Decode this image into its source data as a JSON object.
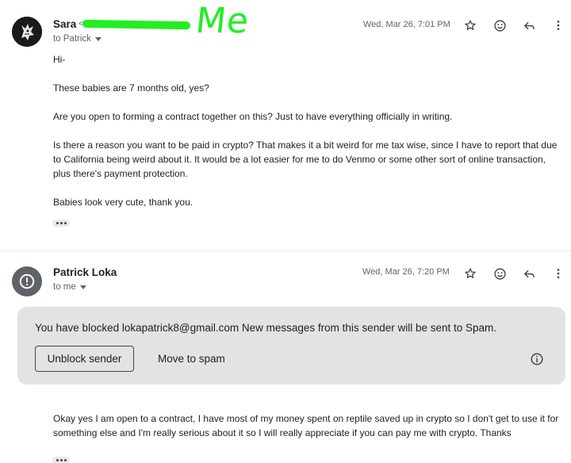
{
  "messages": [
    {
      "sender_name": "Sara",
      "sender_email_visible": "<                    .com>",
      "annotation": "Me",
      "to_label": "to Patrick",
      "date": "Wed, Mar 26, 7:01 PM",
      "paragraphs": [
        "Hi-",
        "These babies are 7 months old, yes?",
        "Are you open to forming a contract together on this? Just to have everything officially in writing.",
        "Is there a reason you want to be paid in crypto? That makes it a bit weird for me tax wise, since I have to report that due to California being weird about it. It would be a lot easier for me to do Venmo or some other sort of online transaction, plus there's payment protection.",
        "Babies look very cute, thank you."
      ]
    },
    {
      "sender_name": "Patrick Loka",
      "to_label": "to me",
      "date": "Wed, Mar 26, 7:20 PM",
      "blocked_notice": {
        "prefix": "You have blocked",
        "email": "lokapatrick8@gmail.com",
        "suffix": "New messages from this sender will be sent to Spam.",
        "unblock_label": "Unblock sender",
        "spam_label": "Move to spam"
      },
      "paragraphs": [
        "Okay yes I am open to a contract,  I have most of my money spent on reptile saved up in crypto so I don't get to use it for something else and I'm really serious about it so I will really appreciate if you can pay me with crypto. Thanks"
      ]
    }
  ],
  "icons": [
    "star-icon",
    "emoji-icon",
    "reply-icon",
    "more-vert-icon",
    "caret-down-icon",
    "alert-icon",
    "info-icon",
    "ellipsis-icon"
  ],
  "colors": {
    "annotation_green": "#22ee22",
    "panel_bg": "#e3e3e3",
    "secondary_text": "#5f6368"
  }
}
